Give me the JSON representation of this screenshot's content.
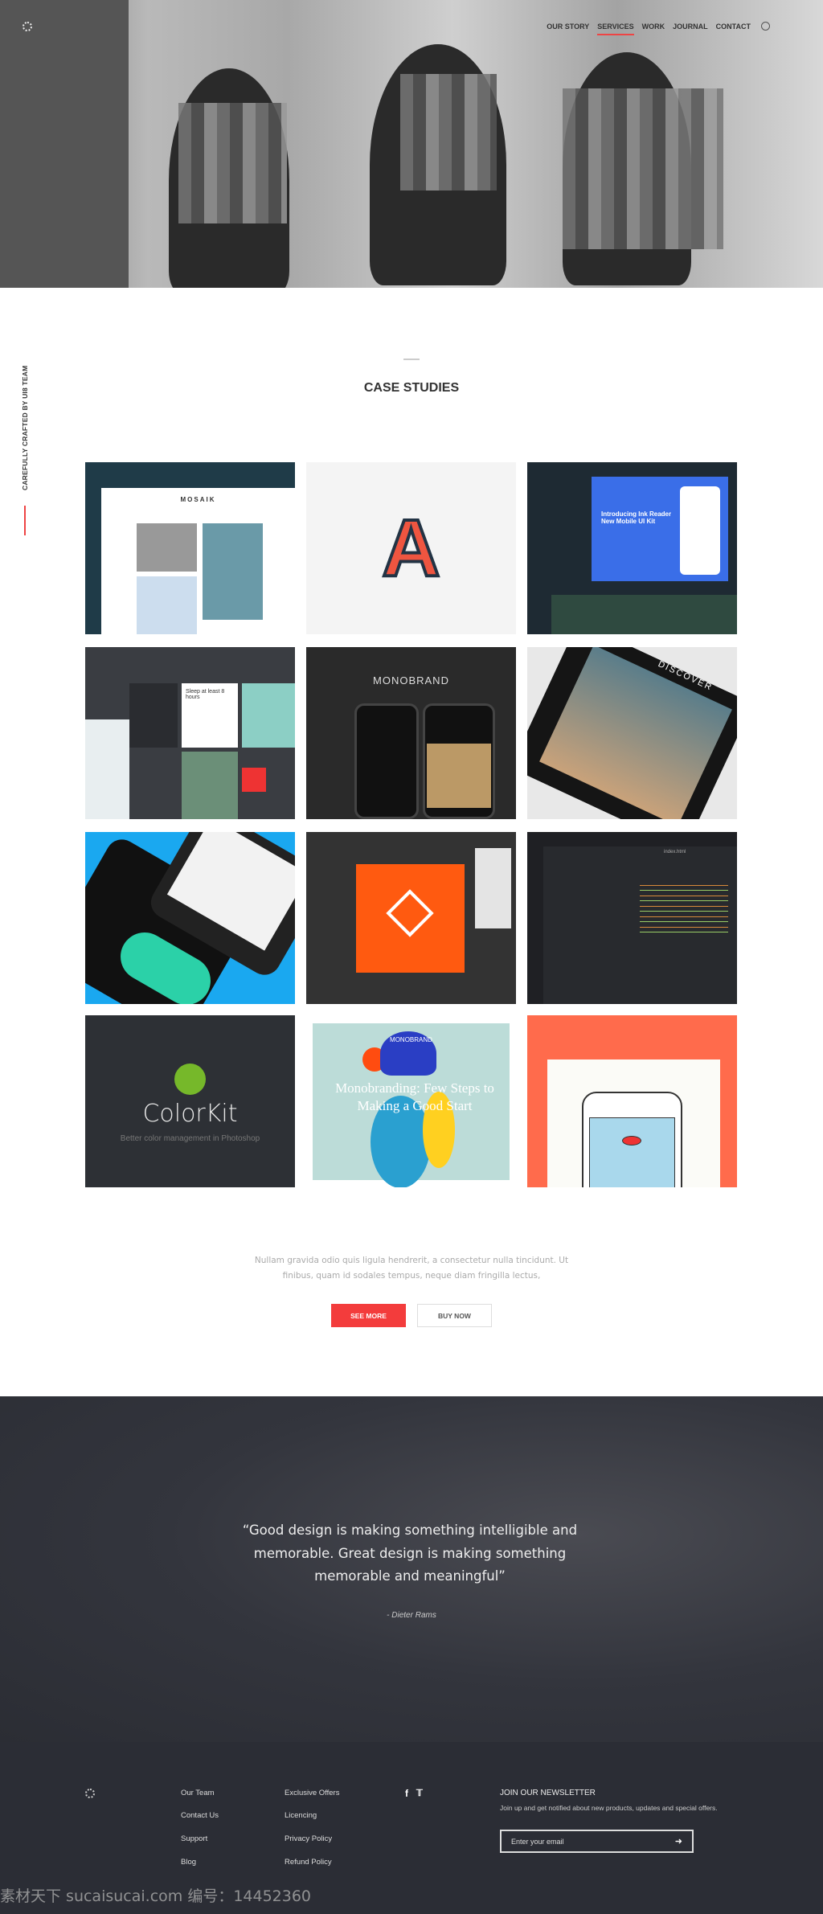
{
  "nav": {
    "items": [
      {
        "label": "OUR STORY"
      },
      {
        "label": "SERVICES",
        "active": true
      },
      {
        "label": "WORK"
      },
      {
        "label": "JOURNAL"
      },
      {
        "label": "CONTACT"
      }
    ],
    "search_icon": "search-icon",
    "accent": "#e44444"
  },
  "sidebar_text": "CAREFULLY CRAFTED BY UI8 TEAM",
  "section": {
    "title": "CASE STUDIES"
  },
  "tiles": [
    {
      "label": "MOSAIK"
    },
    {
      "label": "A"
    },
    {
      "label": "Introducing Ink Reader New Mobile UI Kit"
    },
    {
      "label": "Sleep at least 8 hours"
    },
    {
      "label": "MONOBRAND"
    },
    {
      "label": "DISCOVER"
    },
    {
      "label": ""
    },
    {
      "label": ""
    },
    {
      "label": "index.html"
    },
    {
      "label": "ColorKit",
      "sub": "Better color management in Photoshop"
    },
    {
      "label": "Monobranding: Few Steps to Making a Good Start",
      "sub": "MONOBRAND"
    },
    {
      "label": ""
    }
  ],
  "description": "Nullam gravida odio quis ligula hendrerit, a consectetur nulla tincidunt. Ut finibus, quam id sodales tempus, neque diam fringilla lectus,",
  "buttons": {
    "see_more": "SEE MORE",
    "buy_now": "BUY NOW",
    "primary_color": "#f33c3c"
  },
  "quote": {
    "text": "“Good design is making something intelligible and memorable. Great design is making something memorable and meaningful”",
    "author": "- Dieter Rams"
  },
  "footer": {
    "col1": [
      "Our Team",
      "Contact Us",
      "Support",
      "Blog"
    ],
    "col2": [
      "Exclusive Offers",
      "Licencing",
      "Privacy Policy",
      "Refund Policy"
    ],
    "social": {
      "facebook": "f",
      "twitter": "🐦"
    },
    "newsletter": {
      "title": "JOIN OUR NEWSLETTER",
      "desc": "Join up and get notified about new products, updates and special offers.",
      "placeholder": "Enter your email",
      "submit_icon": "arrow-right-icon"
    }
  },
  "watermark": "素材天下 sucaisucai.com  编号：14452360"
}
